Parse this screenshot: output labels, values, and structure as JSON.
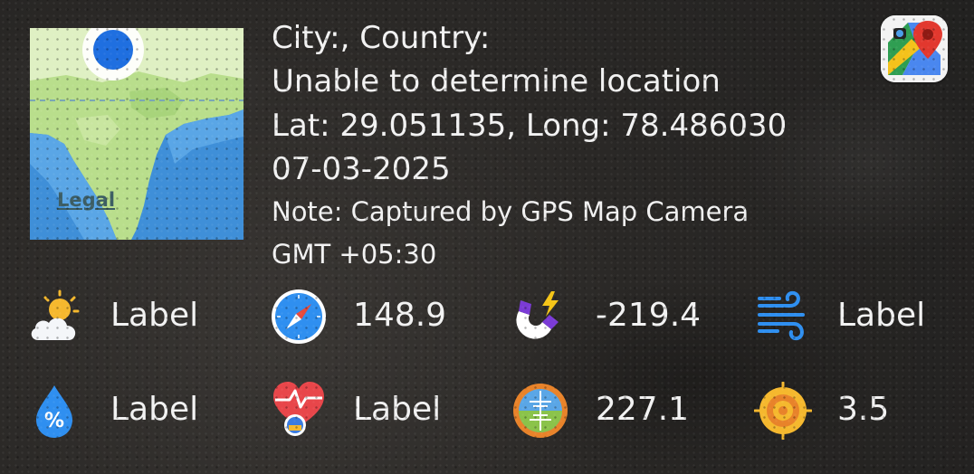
{
  "map": {
    "legal_label": "Legal"
  },
  "info": {
    "city_line": "City:, Country:",
    "address_line": "Unable to determine location",
    "latlong_line": "Lat: 29.051135, Long: 78.486030",
    "date_line": "07-03-2025",
    "note_line": "Note: Captured by GPS Map Camera",
    "gmt_line": "GMT +05:30"
  },
  "metrics": {
    "weather": {
      "icon": "weather-icon",
      "value": "Label"
    },
    "compass": {
      "icon": "compass-icon",
      "value": "148.9"
    },
    "magnetic": {
      "icon": "magnet-icon",
      "value": "-219.4"
    },
    "wind": {
      "icon": "wind-icon",
      "value": "Label"
    },
    "humidity": {
      "icon": "humidity-icon",
      "value": "Label"
    },
    "heart_rate": {
      "icon": "heart-rate-icon",
      "value": "Label"
    },
    "altitude": {
      "icon": "altitude-icon",
      "value": "227.1"
    },
    "accuracy": {
      "icon": "accuracy-icon",
      "value": "3.5"
    }
  },
  "colors": {
    "text": "#f2f2f2",
    "map_water": "#3f8fd8",
    "map_land": "#b9de8c",
    "location_dot": "#1f6fe0"
  }
}
